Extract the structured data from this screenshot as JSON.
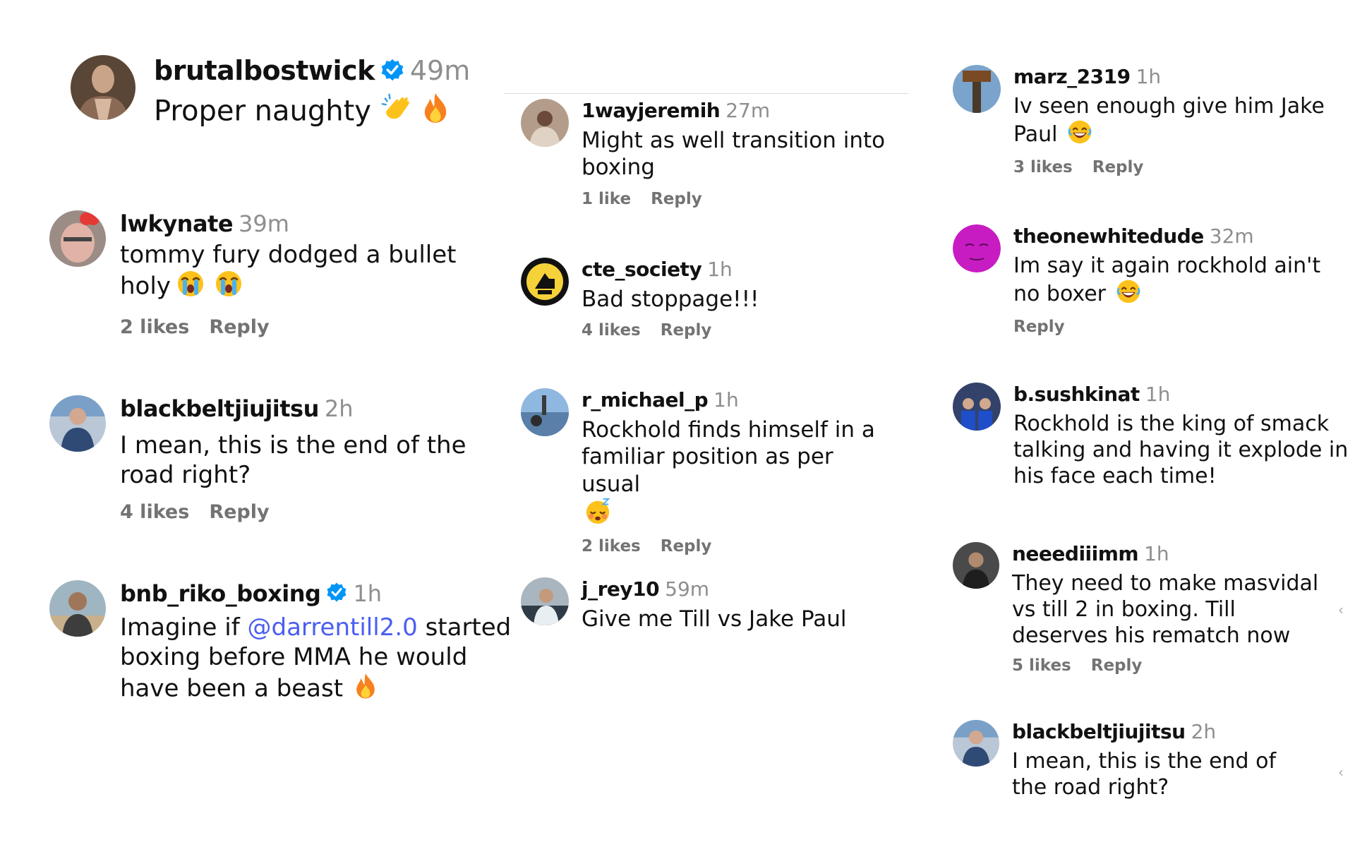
{
  "column_left": {
    "top_comment": {
      "username": "brutalbostwick",
      "time": "49m",
      "text": "Proper naughty",
      "emojis": [
        "clap-emoji",
        "fire-emoji"
      ]
    },
    "comments": [
      {
        "username": "lwkynate",
        "time": "39m",
        "text": "tommy fury dodged a bullet holy",
        "likes": "2 likes",
        "reply": "Reply"
      },
      {
        "username": "blackbeltjiujitsu",
        "time": "2h",
        "text": "I mean, this is the end of the road right?",
        "likes": "4 likes",
        "reply": "Reply"
      },
      {
        "username": "bnb_riko_boxing",
        "time": "1h",
        "text_before": "Imagine if",
        "mention": "@darrentill2.0",
        "text_after": "started boxing before MMA he would have been a beast"
      }
    ]
  },
  "column_middle": {
    "comments": [
      {
        "username": "1wayjeremih",
        "time": "27m",
        "text": "Might as well transition into boxing",
        "likes": "1 like",
        "reply": "Reply"
      },
      {
        "username": "cte_society",
        "time": "1h",
        "text": "Bad stoppage!!!",
        "likes": "4 likes",
        "reply": "Reply"
      },
      {
        "username": "r_michael_p",
        "time": "1h",
        "text": "Rockhold finds himself in a familiar position as per usual",
        "likes": "2 likes",
        "reply": "Reply"
      },
      {
        "username": "j_rey10",
        "time": "59m",
        "text": "Give me Till vs Jake Paul"
      }
    ]
  },
  "column_right": {
    "comments": [
      {
        "username": "marz_2319",
        "time": "1h",
        "text": "Iv seen enough give him Jake Paul",
        "likes": "3 likes",
        "reply": "Reply"
      },
      {
        "username": "theonewhitedude",
        "time": "32m",
        "text": "Im say it again rockhold ain't no boxer",
        "reply": "Reply"
      },
      {
        "username": "b.sushkinat",
        "time": "1h",
        "text": "Rockhold is the king of smack talking and having it explode in his face each time!"
      },
      {
        "username": "neeediiimm",
        "time": "1h",
        "text": "They need to make masvidal vs till 2 in boxing. Till deserves his rematch now",
        "likes": "5 likes",
        "reply": "Reply"
      },
      {
        "username": "blackbeltjiujitsu",
        "time": "2h",
        "text": "I mean, this is the end of the road right?"
      }
    ]
  },
  "colors": {
    "time_gray": "#8e8e8e",
    "meta_gray": "#737373",
    "mention_blue": "#4a5ef0",
    "verified_blue": "#0095f6"
  }
}
